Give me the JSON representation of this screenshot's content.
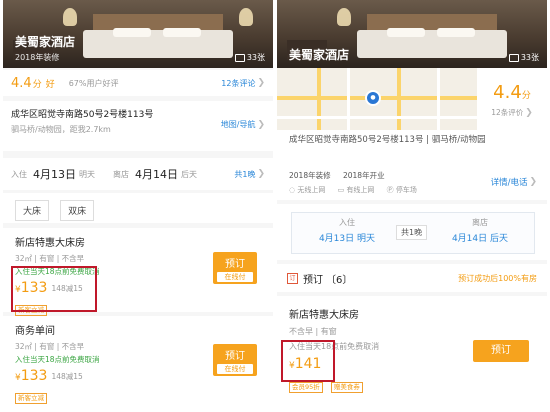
{
  "left": {
    "hotel_name": "美蜀家酒店",
    "renovated": "2018年装修",
    "photo_count": "33张",
    "score": "4.4",
    "score_unit": "分",
    "score_word": "好",
    "recommend": "67%用户好评",
    "review_count": "12条评论",
    "address": "成华区昭觉寺南路50号2号楼113号",
    "nearby": "驷马桥/动物园，距我2.7km",
    "map_nav": "地图/导航",
    "checkin_label": "入住",
    "checkin_date": "4月13日",
    "checkin_day": "明天",
    "checkout_label": "离店",
    "checkout_date": "4月14日",
    "checkout_day": "后天",
    "nights": "共1晚",
    "filters": [
      "大床",
      "双床"
    ],
    "rooms": [
      {
        "name": "新店特惠大床房",
        "specs": "32㎡ | 有窗 | 不含早",
        "policy": "入住当天18点前免费取消",
        "currency": "¥",
        "price": "133",
        "discount": "148减15",
        "badge": "新客立减",
        "book": "预订",
        "pay": "在线付"
      },
      {
        "name": "商务单间",
        "specs": "32㎡ | 有窗 | 不含早",
        "policy": "入住当天18点前免费取消",
        "currency": "¥",
        "price": "133",
        "discount": "148减15",
        "badge": "新客立减",
        "book": "预订",
        "pay": "在线付"
      }
    ]
  },
  "right": {
    "hotel_name": "美蜀家酒店",
    "photo_count": "33张",
    "score": "4.4",
    "score_unit": "分",
    "review_count": "12条评价",
    "address": "成华区昭觉寺南路50号2号楼113号",
    "nearby": "驷马桥/动物园",
    "renovated": "2018年装修",
    "opened": "2018年开业",
    "amenities": [
      "无线上网",
      "有线上网",
      "停车场"
    ],
    "details_link": "详情/电话",
    "checkin_label": "入住",
    "checkin_date": "4月13日",
    "checkin_day": "明天",
    "nights": "共1晚",
    "checkout_label": "离店",
    "checkout_date": "4月14日",
    "checkout_day": "后天",
    "section_title": "预订",
    "section_count": "〔6〕",
    "guarantee": "预订成功后100%有房",
    "room": {
      "name": "新店特惠大床房",
      "specs": "不含早 | 有窗",
      "policy": "入住当天18点前免费取消",
      "currency": "¥",
      "price": "141",
      "tags": [
        "会员95折",
        "赠美食券"
      ],
      "book": "预订"
    }
  },
  "colors": {
    "accent": "#f39c12",
    "link": "#2a87d8",
    "highlight": "#c0182a",
    "policy_green": "#3aa542"
  }
}
